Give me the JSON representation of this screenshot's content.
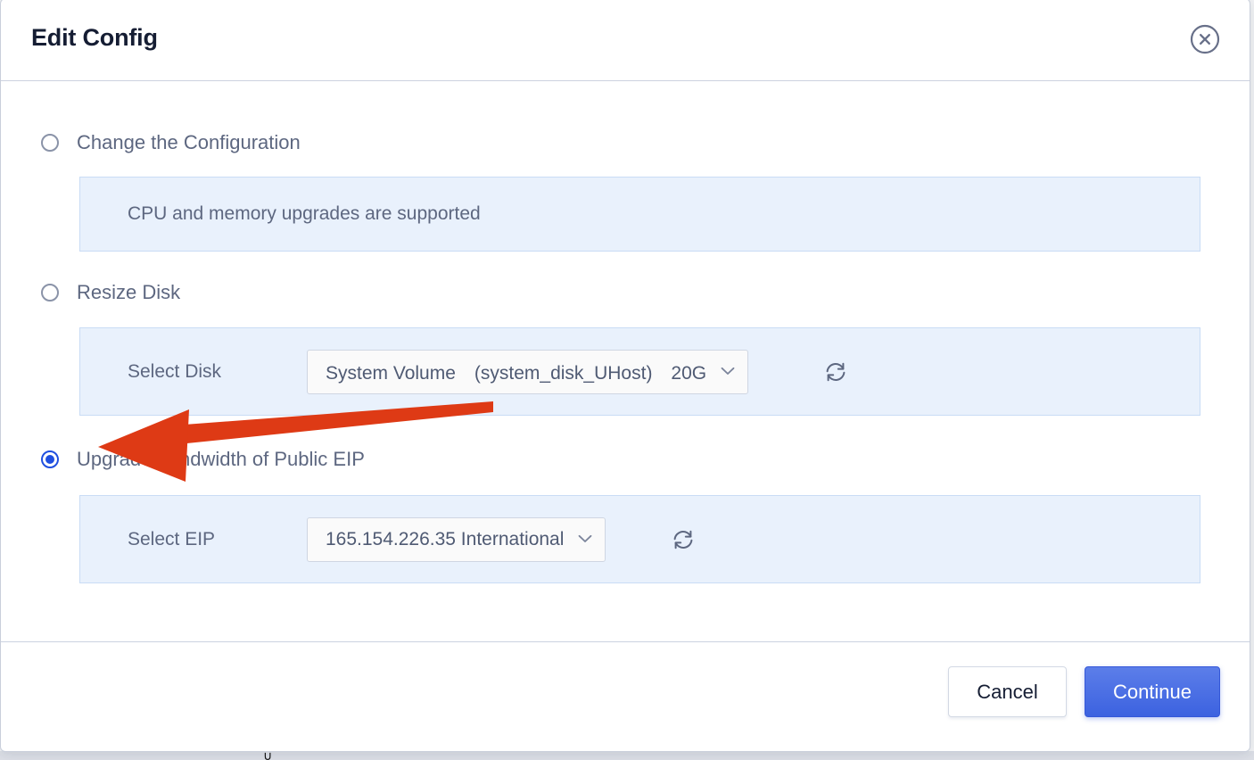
{
  "dialog": {
    "title": "Edit Config",
    "close_icon": "close-circle-icon"
  },
  "options": [
    {
      "id": "change-configuration",
      "label": "Change the Configuration",
      "selected": false
    },
    {
      "id": "resize-disk",
      "label": "Resize Disk",
      "selected": false
    },
    {
      "id": "upgrade-bandwidth-public-eip",
      "label": "Upgrade bandwidth of Public EIP",
      "selected": true
    }
  ],
  "panels": {
    "configuration_note": {
      "text": "CPU and memory upgrades are supported"
    },
    "disk": {
      "label": "Select Disk",
      "value": "System Volume　(system_disk_UHost)　20G",
      "chevron_icon": "chevron-down-icon",
      "refresh_icon": "refresh-icon"
    },
    "eip": {
      "label": "Select EIP",
      "value": "165.154.226.35 International",
      "chevron_icon": "chevron-down-icon",
      "refresh_icon": "refresh-icon"
    }
  },
  "footer": {
    "cancel_label": "Cancel",
    "continue_label": "Continue"
  },
  "annotation": {
    "type": "arrow",
    "color": "#DE3A15",
    "points_to": "upgrade-bandwidth-public-eip"
  },
  "colors": {
    "accent": "#3C62E0",
    "radio_selected": "#1F4FE0",
    "panel_bg": "#E9F1FC",
    "panel_border": "#C9DCF5",
    "title": "#151D33",
    "body_text": "#5D6780",
    "annotation": "#DE3A15"
  },
  "misc": {
    "bottom_glyph": "∪"
  }
}
